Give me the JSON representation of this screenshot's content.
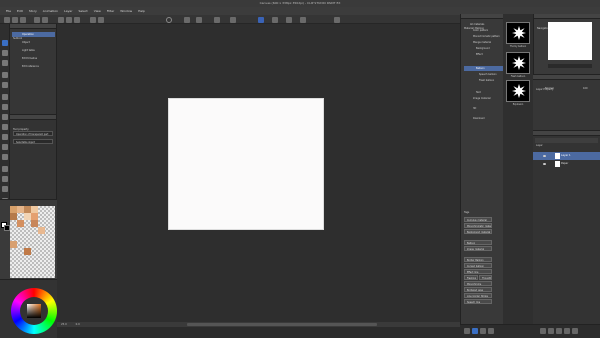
{
  "window": {
    "title": "Canvas (600 x 338px 350dpi) - CLIP STUDIO PAINT EX"
  },
  "menu": [
    "File",
    "Edit",
    "Story",
    "Animation",
    "Layer",
    "Select",
    "View",
    "Filter",
    "Window",
    "Help"
  ],
  "subtool": {
    "header": "Subtool",
    "items": [
      "Operation",
      "Object",
      "Light table",
      "Edit timeline"
    ],
    "tab": "Edit reference"
  },
  "tool_property": {
    "header": "Tool property",
    "fields": [
      "Operation of transparent part",
      "Selectable object"
    ]
  },
  "status": {
    "zoom": "25.0",
    "angle": "0.0"
  },
  "materials": {
    "header": "Material: Balloon",
    "items": [
      "All materials",
      "Color pattern",
      "Monochromatic pattern",
      "Manga material",
      "Background",
      "Effect",
      "Balloon",
      "Speech balloon",
      "Flash balloon",
      "Text",
      "Image material",
      "3D",
      "Download"
    ],
    "search_header": "Tags",
    "tags": [
      "Cumulus_material",
      "Monochromatic_material",
      "Background_material",
      "Balloon",
      "Image_material",
      "Border_Balloon",
      "Curved_balloon",
      "Effect_line",
      "Flashing",
      "Thought",
      "Monochrome",
      "Bordered_area",
      "Line_border_Stroke",
      "Speech_line"
    ],
    "thumb_labels": [
      "Thorny balloon",
      "Flash balloon",
      "Explosion"
    ]
  },
  "navigator": {
    "header": "Navigator"
  },
  "layer_property": {
    "header": "Layer Property",
    "mode": "Normal",
    "opacity": "100"
  },
  "layers": {
    "header": "Layer",
    "rows": [
      {
        "name": "Layer 1",
        "selected": true
      },
      {
        "name": "Paper",
        "selected": false
      }
    ]
  },
  "colors": {
    "accent": "#4c6aa1",
    "canvas": "#fbfafa",
    "background": "#2e2e2e"
  }
}
